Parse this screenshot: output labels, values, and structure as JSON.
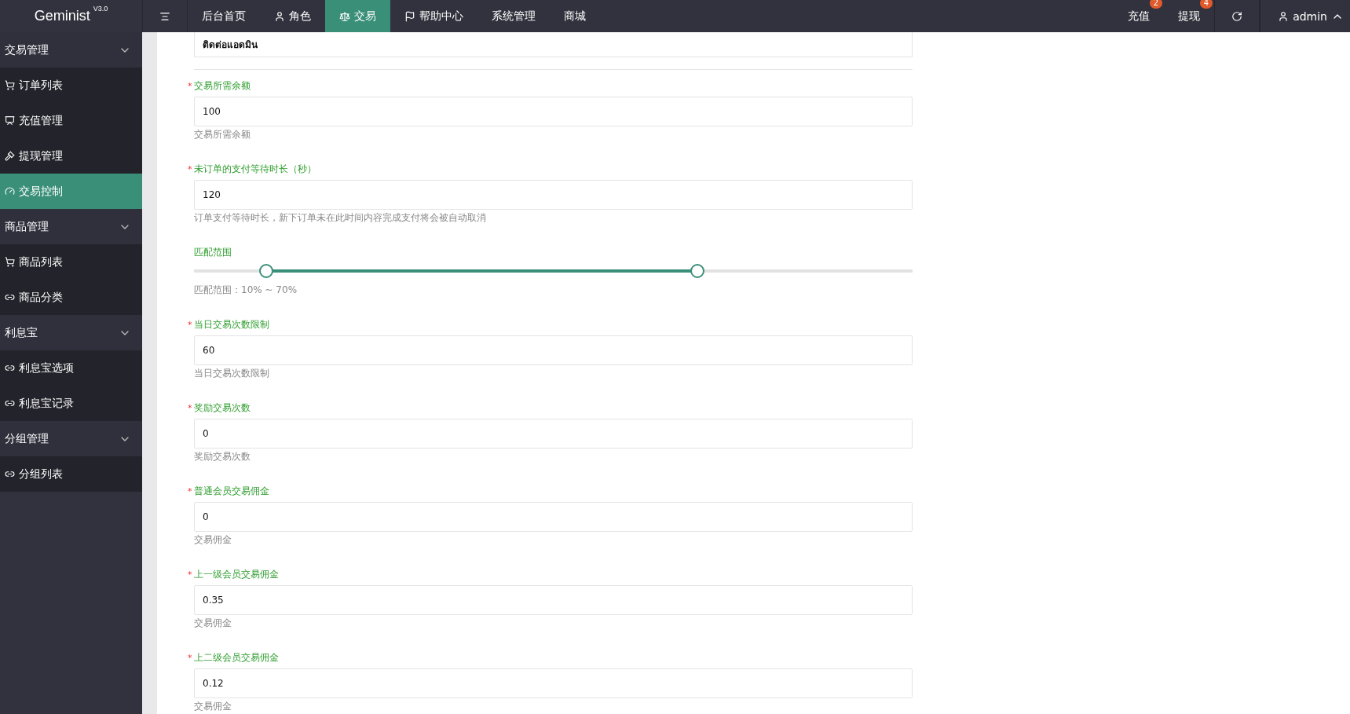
{
  "header": {
    "logo": "Geminist",
    "version": "V3.0",
    "nav": [
      {
        "label": "后台首页",
        "selected": false
      },
      {
        "label": "角色",
        "selected": false
      },
      {
        "label": "交易",
        "selected": true
      },
      {
        "label": "帮助中心",
        "selected": false
      },
      {
        "label": "系统管理",
        "selected": false
      },
      {
        "label": "商城",
        "selected": false
      }
    ],
    "actions": [
      {
        "label": "充值",
        "badge": "2"
      },
      {
        "label": "提现",
        "badge": "4"
      }
    ],
    "user": "admin"
  },
  "sidebar": {
    "groups": [
      {
        "label": "交易管理",
        "expanded": true,
        "children": [
          {
            "label": "订单列表",
            "selected": false
          },
          {
            "label": "充值管理",
            "selected": false
          },
          {
            "label": "提现管理",
            "selected": false
          },
          {
            "label": "交易控制",
            "selected": true
          }
        ]
      },
      {
        "label": "商品管理",
        "expanded": true,
        "children": [
          {
            "label": "商品列表",
            "selected": false
          },
          {
            "label": "商品分类",
            "selected": false
          }
        ]
      },
      {
        "label": "利息宝",
        "expanded": true,
        "children": [
          {
            "label": "利息宝选项",
            "selected": false
          },
          {
            "label": "利息宝记录",
            "selected": false
          }
        ]
      },
      {
        "label": "分组管理",
        "expanded": true,
        "children": [
          {
            "label": "分组列表",
            "selected": false
          }
        ]
      }
    ]
  },
  "form": {
    "required_mark": "*",
    "top_field": {
      "value": "ติดต่อแอดมิน"
    },
    "fields": [
      {
        "kind": "input",
        "label": "交易所需余额",
        "required": true,
        "value": "100",
        "help": "交易所需余额"
      },
      {
        "kind": "input",
        "label": "未订单的支付等待时长（秒）",
        "required": true,
        "value": "120",
        "help": "订单支付等待时长，新下订单未在此时间内容完成支付将会被自动取消"
      },
      {
        "kind": "range",
        "label": "匹配范围",
        "required": false,
        "low": {
          "level": 0.1
        },
        "high": {
          "level": 0.7
        },
        "help": "匹配范围：10% ~ 70%"
      },
      {
        "kind": "input",
        "label": "当日交易次数限制",
        "required": true,
        "value": "60",
        "help": "当日交易次数限制"
      },
      {
        "kind": "input",
        "label": "奖励交易次数",
        "required": true,
        "value": "0",
        "help": "奖励交易次数"
      },
      {
        "kind": "input",
        "label": "普通会员交易佣金",
        "required": true,
        "value": "0",
        "help": "交易佣金"
      },
      {
        "kind": "input",
        "label": "上一级会员交易佣金",
        "required": true,
        "value": "0.35",
        "help": "交易佣金"
      },
      {
        "kind": "input",
        "label": "上二级会员交易佣金",
        "required": true,
        "value": "0.12",
        "help": "交易佣金"
      }
    ]
  }
}
